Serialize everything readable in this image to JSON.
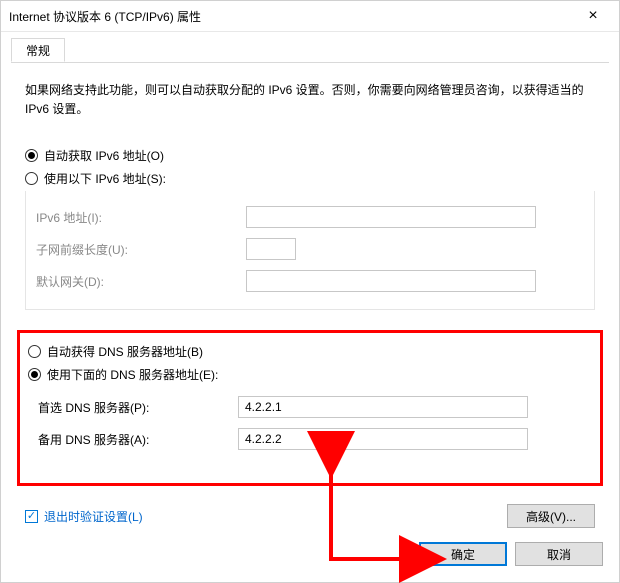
{
  "window": {
    "title": "Internet 协议版本 6 (TCP/IPv6) 属性"
  },
  "tabs": {
    "general": "常规"
  },
  "description": "如果网络支持此功能，则可以自动获取分配的 IPv6 设置。否则，你需要向网络管理员咨询，以获得适当的 IPv6 设置。",
  "ip_section": {
    "auto_label": "自动获取 IPv6 地址(O)",
    "manual_label": "使用以下 IPv6 地址(S):",
    "selected": "auto",
    "fields": {
      "addr_label": "IPv6 地址(I):",
      "addr_value": "",
      "prefix_label": "子网前缀长度(U):",
      "prefix_value": "",
      "gateway_label": "默认网关(D):",
      "gateway_value": ""
    }
  },
  "dns_section": {
    "auto_label": "自动获得 DNS 服务器地址(B)",
    "manual_label": "使用下面的 DNS 服务器地址(E):",
    "selected": "manual",
    "fields": {
      "preferred_label": "首选 DNS 服务器(P):",
      "preferred_value": "4.2.2.1",
      "alternate_label": "备用 DNS 服务器(A):",
      "alternate_value": "4.2.2.2"
    }
  },
  "validate_on_exit": {
    "label": "退出时验证设置(L)",
    "checked": true
  },
  "buttons": {
    "advanced": "高级(V)...",
    "ok": "确定",
    "cancel": "取消"
  }
}
